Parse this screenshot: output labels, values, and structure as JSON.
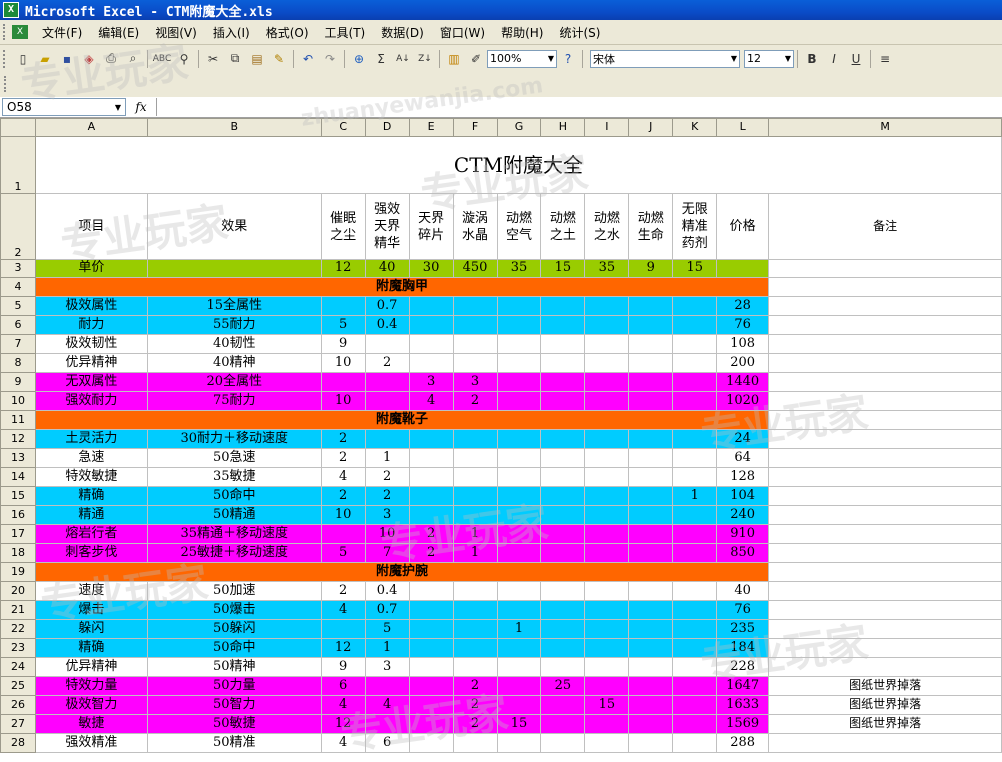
{
  "window": {
    "title": "Microsoft Excel - CTM附魔大全.xls"
  },
  "menu": [
    "文件(F)",
    "编辑(E)",
    "视图(V)",
    "插入(I)",
    "格式(O)",
    "工具(T)",
    "数据(D)",
    "窗口(W)",
    "帮助(H)",
    "统计(S)"
  ],
  "toolbar": {
    "zoom": "100%",
    "font": "宋体",
    "font_size": "12",
    "bold": "B",
    "italic": "I",
    "underline": "U"
  },
  "formula_bar": {
    "name_box": "O58",
    "fx": "fx",
    "value": ""
  },
  "columns": [
    "A",
    "B",
    "C",
    "D",
    "E",
    "F",
    "G",
    "H",
    "I",
    "J",
    "K",
    "L",
    "M"
  ],
  "sheet": {
    "title": "CTM附魔大全",
    "headers": [
      "项目",
      "效果",
      "催眠之尘",
      "强效天界精华",
      "天界碎片",
      "漩涡水晶",
      "动燃空气",
      "动燃之土",
      "动燃之水",
      "动燃生命",
      "无限精准药剂",
      "价格",
      "备注"
    ],
    "unit_price": {
      "label": "单价",
      "values": [
        "12",
        "40",
        "30",
        "450",
        "35",
        "15",
        "35",
        "9",
        "15"
      ]
    },
    "sections": {
      "chest": "附魔胸甲",
      "boots": "附魔靴子",
      "bracer": "附魔护腕"
    },
    "rows": [
      {
        "n": "5",
        "color": "cyan",
        "item": "极效属性",
        "effect": "15全属性",
        "c": "",
        "d": "0.7",
        "e": "",
        "f": "",
        "g": "",
        "h": "",
        "i": "",
        "j": "",
        "k": "",
        "price": "28",
        "note": ""
      },
      {
        "n": "6",
        "color": "cyan",
        "item": "耐力",
        "effect": "55耐力",
        "c": "5",
        "d": "0.4",
        "e": "",
        "f": "",
        "g": "",
        "h": "",
        "i": "",
        "j": "",
        "k": "",
        "price": "76",
        "note": ""
      },
      {
        "n": "7",
        "color": "white",
        "item": "极效韧性",
        "effect": "40韧性",
        "c": "9",
        "d": "",
        "e": "",
        "f": "",
        "g": "",
        "h": "",
        "i": "",
        "j": "",
        "k": "",
        "price": "108",
        "note": ""
      },
      {
        "n": "8",
        "color": "white",
        "item": "优异精神",
        "effect": "40精神",
        "c": "10",
        "d": "2",
        "e": "",
        "f": "",
        "g": "",
        "h": "",
        "i": "",
        "j": "",
        "k": "",
        "price": "200",
        "note": ""
      },
      {
        "n": "9",
        "color": "mag",
        "item": "无双属性",
        "effect": "20全属性",
        "c": "",
        "d": "",
        "e": "3",
        "f": "3",
        "g": "",
        "h": "",
        "i": "",
        "j": "",
        "k": "",
        "price": "1440",
        "note": ""
      },
      {
        "n": "10",
        "color": "mag",
        "item": "强效耐力",
        "effect": "75耐力",
        "c": "10",
        "d": "",
        "e": "4",
        "f": "2",
        "g": "",
        "h": "",
        "i": "",
        "j": "",
        "k": "",
        "price": "1020",
        "note": ""
      },
      {
        "n": "12",
        "color": "cyan",
        "item": "土灵活力",
        "effect": "30耐力＋移动速度",
        "c": "2",
        "d": "",
        "e": "",
        "f": "",
        "g": "",
        "h": "",
        "i": "",
        "j": "",
        "k": "",
        "price": "24",
        "note": ""
      },
      {
        "n": "13",
        "color": "white",
        "item": "急速",
        "effect": "50急速",
        "c": "2",
        "d": "1",
        "e": "",
        "f": "",
        "g": "",
        "h": "",
        "i": "",
        "j": "",
        "k": "",
        "price": "64",
        "note": ""
      },
      {
        "n": "14",
        "color": "white",
        "item": "特效敏捷",
        "effect": "35敏捷",
        "c": "4",
        "d": "2",
        "e": "",
        "f": "",
        "g": "",
        "h": "",
        "i": "",
        "j": "",
        "k": "",
        "price": "128",
        "note": ""
      },
      {
        "n": "15",
        "color": "cyan",
        "item": "精确",
        "effect": "50命中",
        "c": "2",
        "d": "2",
        "e": "",
        "f": "",
        "g": "",
        "h": "",
        "i": "",
        "j": "",
        "k": "1",
        "price": "104",
        "note": ""
      },
      {
        "n": "16",
        "color": "cyan",
        "item": "精通",
        "effect": "50精通",
        "c": "10",
        "d": "3",
        "e": "",
        "f": "",
        "g": "",
        "h": "",
        "i": "",
        "j": "",
        "k": "",
        "price": "240",
        "note": ""
      },
      {
        "n": "17",
        "color": "mag",
        "item": "熔岩行者",
        "effect": "35精通＋移动速度",
        "c": "",
        "d": "10",
        "e": "2",
        "f": "1",
        "g": "",
        "h": "",
        "i": "",
        "j": "",
        "k": "",
        "price": "910",
        "note": ""
      },
      {
        "n": "18",
        "color": "mag",
        "item": "刺客步伐",
        "effect": "25敏捷＋移动速度",
        "c": "5",
        "d": "7",
        "e": "2",
        "f": "1",
        "g": "",
        "h": "",
        "i": "",
        "j": "",
        "k": "",
        "price": "850",
        "note": ""
      },
      {
        "n": "20",
        "color": "white",
        "item": "速度",
        "effect": "50加速",
        "c": "2",
        "d": "0.4",
        "e": "",
        "f": "",
        "g": "",
        "h": "",
        "i": "",
        "j": "",
        "k": "",
        "price": "40",
        "note": ""
      },
      {
        "n": "21",
        "color": "cyan",
        "item": "爆击",
        "effect": "50爆击",
        "c": "4",
        "d": "0.7",
        "e": "",
        "f": "",
        "g": "",
        "h": "",
        "i": "",
        "j": "",
        "k": "",
        "price": "76",
        "note": ""
      },
      {
        "n": "22",
        "color": "cyan",
        "item": "躲闪",
        "effect": "50躲闪",
        "c": "",
        "d": "5",
        "e": "",
        "f": "",
        "g": "1",
        "h": "",
        "i": "",
        "j": "",
        "k": "",
        "price": "235",
        "note": ""
      },
      {
        "n": "23",
        "color": "cyan",
        "item": "精确",
        "effect": "50命中",
        "c": "12",
        "d": "1",
        "e": "",
        "f": "",
        "g": "",
        "h": "",
        "i": "",
        "j": "",
        "k": "",
        "price": "184",
        "note": ""
      },
      {
        "n": "24",
        "color": "white",
        "item": "优异精神",
        "effect": "50精神",
        "c": "9",
        "d": "3",
        "e": "",
        "f": "",
        "g": "",
        "h": "",
        "i": "",
        "j": "",
        "k": "",
        "price": "228",
        "note": ""
      },
      {
        "n": "25",
        "color": "mag",
        "item": "特效力量",
        "effect": "50力量",
        "c": "6",
        "d": "",
        "e": "",
        "f": "2",
        "g": "",
        "h": "25",
        "i": "",
        "j": "",
        "k": "",
        "price": "1647",
        "note": "图纸世界掉落"
      },
      {
        "n": "26",
        "color": "mag",
        "item": "极效智力",
        "effect": "50智力",
        "c": "4",
        "d": "4",
        "e": "",
        "f": "2",
        "g": "",
        "h": "",
        "i": "15",
        "j": "",
        "k": "",
        "price": "1633",
        "note": "图纸世界掉落"
      },
      {
        "n": "27",
        "color": "mag",
        "item": "敏捷",
        "effect": "50敏捷",
        "c": "12",
        "d": "",
        "e": "",
        "f": "2",
        "g": "15",
        "h": "",
        "i": "",
        "j": "",
        "k": "",
        "price": "1569",
        "note": "图纸世界掉落"
      },
      {
        "n": "28",
        "color": "white",
        "item": "强效精准",
        "effect": "50精准",
        "c": "4",
        "d": "6",
        "e": "",
        "f": "",
        "g": "",
        "h": "",
        "i": "",
        "j": "",
        "k": "",
        "price": "288",
        "note": ""
      }
    ]
  },
  "watermark": {
    "cn": "专业玩家",
    "url": "zhuanyewanjia.com"
  }
}
